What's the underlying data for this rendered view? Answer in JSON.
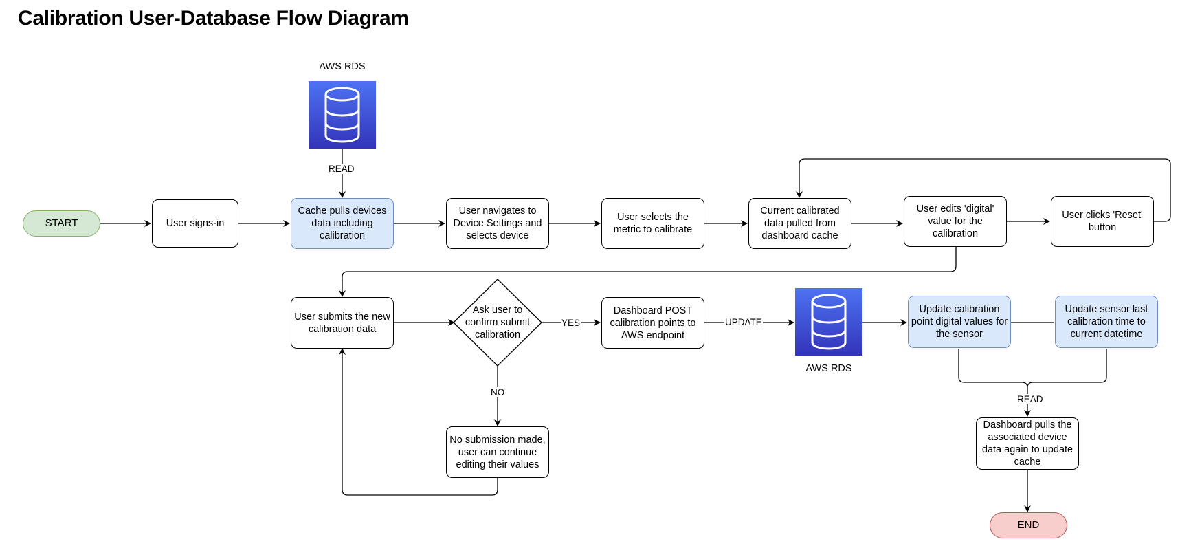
{
  "title": "Calibration User-Database Flow Diagram",
  "nodes": {
    "start": "START",
    "sign_in": "User signs-in",
    "cache_pull": "Cache pulls devices data including calibration",
    "navigate": "User navigates to Device Settings and selects device",
    "select_metric": "User selects the metric to calibrate",
    "current_data": "Current calibrated data pulled from dashboard cache",
    "edit_digital": "User edits 'digital' value for the calibration",
    "reset": "User clicks 'Reset' button",
    "submit": "User submits the new calibration data",
    "confirm": "Ask user to confirm submit calibration",
    "post": "Dashboard POST calibration points to AWS endpoint",
    "no_submission": "No submission made, user can continue editing their values",
    "update_points": "Update calibration point digital values for the sensor",
    "update_time": "Update sensor last calibration time to current datetime",
    "dashboard_pull": "Dashboard pulls the associated device data again to update cache",
    "end": "END"
  },
  "databases": {
    "top": {
      "label": "AWS RDS",
      "icon": "database-icon"
    },
    "bottom": {
      "label": "AWS RDS",
      "icon": "database-icon"
    }
  },
  "edge_labels": {
    "read_top": "READ",
    "yes": "YES",
    "no": "NO",
    "update": "UPDATE",
    "read_bottom": "READ"
  },
  "colors": {
    "start_fill": "#d5e8d4",
    "start_stroke": "#82b366",
    "end_fill": "#f8cecc",
    "end_stroke": "#b85450",
    "db_fill": "#dae8fc",
    "db_stroke": "#6c8ebf",
    "rds_top": "#4d72f3",
    "rds_bottom": "#3334b9"
  }
}
